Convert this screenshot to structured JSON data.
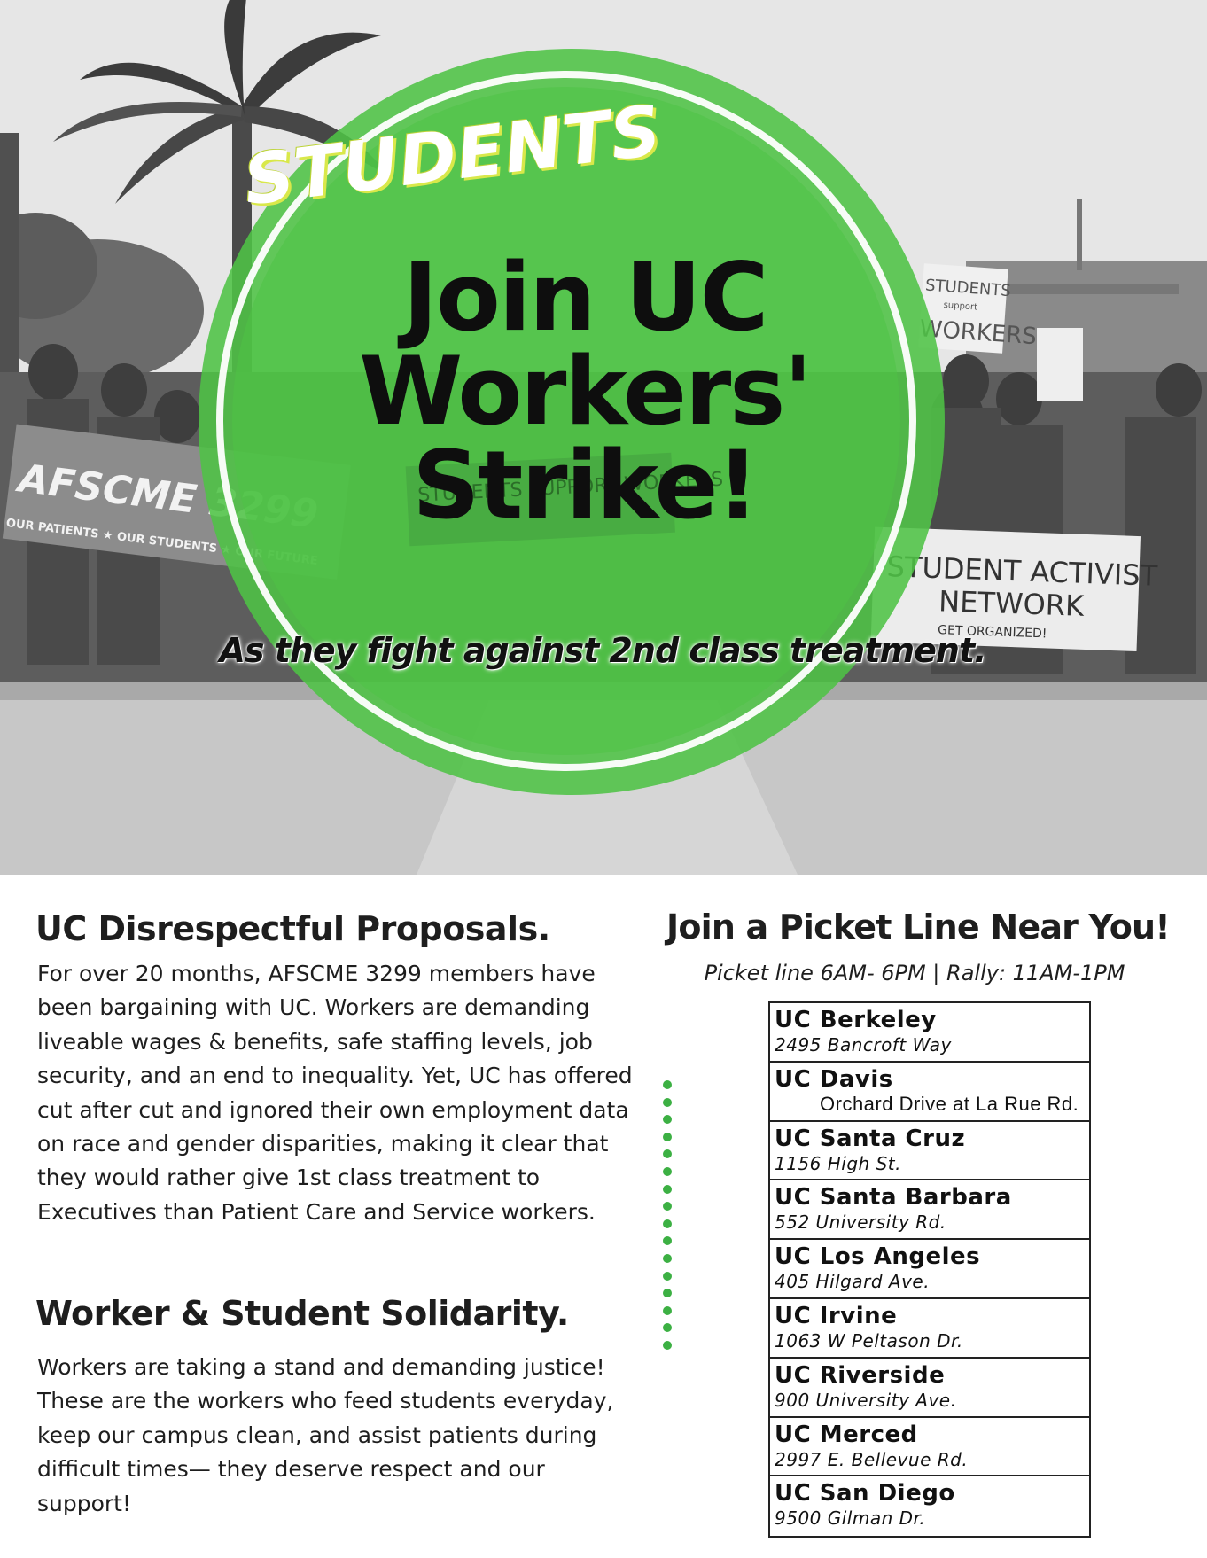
{
  "hero": {
    "kicker": "STUDENTS",
    "headline_lines": [
      "Join UC",
      "Workers'",
      "Strike!"
    ],
    "subhead": "As they fight against 2nd class treatment.",
    "accent_color": "#4ec346"
  },
  "proposals": {
    "title": "UC Disrespectful Proposals.",
    "lines": [
      "For over 20 months, AFSCME 3299 members have",
      "been bargaining with UC. Workers are demanding",
      "liveable wages & benefits, safe staffing levels, job",
      "security, and an end to inequality. Yet, UC has offered",
      "cut after cut and ignored their own employment data",
      "on race and gender disparities, making it clear that",
      "they would rather give 1st class treatment to",
      "Executives than Patient Care and Service workers."
    ]
  },
  "solidarity": {
    "title": "Worker & Student Solidarity.",
    "lines": [
      "Workers are taking a stand and demanding justice!",
      "These are the workers who feed students everyday,",
      "keep our campus clean, and assist patients during",
      "difficult times— they deserve respect and our",
      "support!"
    ]
  },
  "picket": {
    "title": "Join a Picket Line Near You!",
    "hours": "Picket line 6AM- 6PM | Rally: 11AM-1PM",
    "campuses": [
      {
        "name": "UC Berkeley",
        "address": "2495 Bancroft Way"
      },
      {
        "name": "UC Davis",
        "address": "Orchard Drive at La Rue Rd."
      },
      {
        "name": "UC Santa Cruz",
        "address": "1156 High St."
      },
      {
        "name": "UC Santa Barbara",
        "address": "552 University Rd."
      },
      {
        "name": "UC Los Angeles",
        "address": "405 Hilgard Ave."
      },
      {
        "name": "UC Irvine",
        "address": "1063 W Peltason Dr."
      },
      {
        "name": "UC Riverside",
        "address": "900 University Ave."
      },
      {
        "name": "UC Merced",
        "address": "2997 E. Bellevue Rd."
      },
      {
        "name": "UC San Diego",
        "address": "9500 Gilman Dr."
      }
    ]
  },
  "photo_signs": {
    "banner": "AFSCME 3299",
    "banner_tagline": "OUR PATIENTS ★ OUR STUDENTS ★ OUR FUTURE",
    "sign_right_line1": "STUDENT ACTIVIST",
    "sign_right_line2": "NETWORK",
    "sign_right_line3": "GET ORGANIZED!",
    "sign_top_right_line1": "STUDENTS",
    "sign_top_right_line2": "support",
    "sign_top_right_line3": "WORKERS",
    "sign_center": "STUDENTS SUPPORT WORKERS"
  }
}
